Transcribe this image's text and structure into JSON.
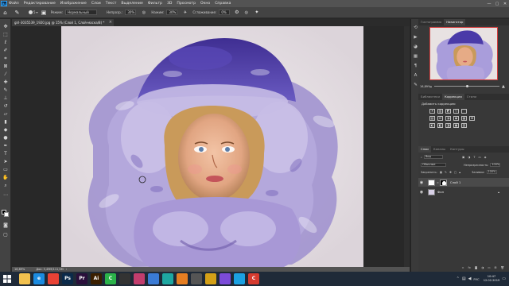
{
  "app": {
    "logo": "Ps"
  },
  "menu": [
    "Файл",
    "Редактирование",
    "Изображение",
    "Слои",
    "Текст",
    "Выделение",
    "Фильтр",
    "3D",
    "Просмотр",
    "Окно",
    "Справка"
  ],
  "window_controls": [
    "—",
    "▢",
    "✕"
  ],
  "options": {
    "brush_size": "5",
    "mode_label": "Режим:",
    "mode_value": "Нормальный",
    "opacity_label": "Непрозр.:",
    "opacity_value": "30%",
    "flow_label": "Нажим:",
    "flow_value": "30%",
    "smoothing_label": "Сглаживание:",
    "smoothing_value": "0%"
  },
  "document": {
    "tab_title": "girl-3035539_1920.jpg @ 15% (Слой 1, Слой-маска/8) *",
    "close": "×"
  },
  "status": {
    "zoom": "16,89%",
    "doc_info": "Док: 5,49M/111,5M"
  },
  "navigator": {
    "tabs": [
      "Гистограмма",
      "Навигатор"
    ],
    "active_tab": 1,
    "zoom": "16,89%"
  },
  "adjustments": {
    "tabs": [
      "Библиотеки",
      "Коррекция",
      "Стили"
    ],
    "active_tab": 1,
    "title": "Добавить коррекцию",
    "rows": [
      [
        "☀",
        "▥",
        "◩",
        "▽",
        "⌒"
      ],
      [
        "▤",
        "⚖",
        "◑",
        "◉",
        "▦",
        "⊞"
      ],
      [
        "◐",
        "◧",
        "◨",
        "▣",
        "▧"
      ]
    ]
  },
  "layers": {
    "tabs": [
      "Слои",
      "Каналы",
      "Контуры"
    ],
    "active_tab": 0,
    "filter_label": "Вид",
    "blend_mode": "Обычные",
    "opacity_label": "Непрозрачность:",
    "opacity_value": "100%",
    "lock_label": "Закрепить:",
    "fill_label": "Заливка:",
    "fill_value": "100%",
    "items": [
      {
        "name": "Слой 1",
        "visible": true,
        "active": true,
        "has_mask": true
      },
      {
        "name": "Фон",
        "visible": true,
        "active": false,
        "has_mask": false
      }
    ]
  },
  "taskbar": {
    "apps": [
      {
        "name": "explorer",
        "label": "",
        "color": "#f2c14e"
      },
      {
        "name": "ie",
        "label": "e",
        "color": "#1b8be0"
      },
      {
        "name": "chrome",
        "label": "",
        "color": "#e94235"
      },
      {
        "name": "photoshop",
        "label": "Ps",
        "color": "#0b2a4a"
      },
      {
        "name": "premiere",
        "label": "Pr",
        "color": "#2a0f3b"
      },
      {
        "name": "illustrator",
        "label": "Ai",
        "color": "#3b1f00"
      },
      {
        "name": "app-green",
        "label": "C",
        "color": "#2bb34a"
      },
      {
        "name": "app-dark",
        "label": "",
        "color": "#333"
      },
      {
        "name": "app-rose",
        "label": "",
        "color": "#c23d6d"
      },
      {
        "name": "app-blue",
        "label": "",
        "color": "#3a7bd5"
      },
      {
        "name": "app-teal",
        "label": "",
        "color": "#1ea7a1"
      },
      {
        "name": "app-orange",
        "label": "",
        "color": "#e67e22"
      },
      {
        "name": "app-gray",
        "label": "",
        "color": "#555"
      },
      {
        "name": "app-gold",
        "label": "",
        "color": "#d4a017"
      },
      {
        "name": "app-violet",
        "label": "",
        "color": "#7b4bd8"
      },
      {
        "name": "app-cyan",
        "label": "",
        "color": "#1ba1e2"
      },
      {
        "name": "app-red",
        "label": "C",
        "color": "#d63b2f"
      }
    ],
    "lang": "РУС",
    "time": "10:47",
    "date": "12.02.2019"
  }
}
